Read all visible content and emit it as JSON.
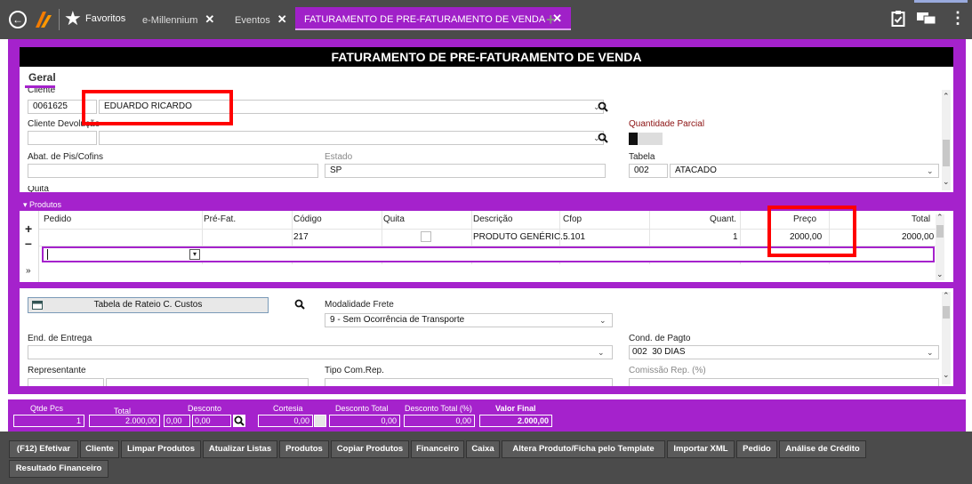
{
  "topbar": {
    "favoritos": "Favoritos",
    "tabs": [
      {
        "label": "e-Millennium"
      },
      {
        "label": "Eventos"
      },
      {
        "label": "FATURAMENTO DE PRE-FATURAMENTO DE VENDA"
      }
    ]
  },
  "title": "FATURAMENTO DE PRE-FATURAMENTO DE VENDA",
  "geral_tab": "Geral",
  "form": {
    "cliente_label": "Cliente",
    "cliente_code": "0061625",
    "cliente_name": "EDUARDO RICARDO",
    "cliente_devolucao_label": "Cliente Devolução",
    "quantidade_parcial_label": "Quantidade Parcial",
    "abat_label": "Abat. de Pis/Cofins",
    "estado_label": "Estado",
    "estado_value": "SP",
    "tabela_label": "Tabela",
    "tabela_code": "002",
    "tabela_name": "ATACADO",
    "quita_label": "Quita"
  },
  "produtos": {
    "header": "Produtos",
    "columns": [
      "Pedido",
      "Pré-Fat.",
      "Código",
      "Quita",
      "Descrição",
      "Cfop",
      "Quant.",
      "Preço",
      "Total"
    ],
    "rows": [
      {
        "codigo": "217",
        "descricao": "PRODUTO GENÉRIC...",
        "cfop": "5.101",
        "quant": "1",
        "preco": "2000,00",
        "total": "2000,00"
      }
    ]
  },
  "lower": {
    "tabela_rateio": "Tabela de Rateio C. Custos",
    "modalidade_label": "Modalidade Frete",
    "modalidade_value": "9 - Sem Ocorrência de Transporte",
    "end_entrega_label": "End. de Entrega",
    "cond_pagto_label": "Cond. de Pagto",
    "cond_pagto_code": "002",
    "cond_pagto_value": "30 DIAS",
    "representante_label": "Representante",
    "tipo_com_label": "Tipo Com.Rep.",
    "comissao_label": "Comissão Rep. (%)"
  },
  "summary": {
    "qtde_label": "Qtde Pcs",
    "qtde_value": "1",
    "total_label": "Total",
    "total_value": "2.000,00",
    "desconto_label": "Desconto",
    "desconto_a": "0,00",
    "desconto_b": "0,00",
    "cortesia_label": "Cortesia",
    "cortesia_value": "0,00",
    "desconto_total_label": "Desconto Total",
    "desconto_total_value": "0,00",
    "desconto_total_pct_label": "Desconto Total (%)",
    "desconto_total_pct_value": "0,00",
    "valor_final_label": "Valor Final",
    "valor_final_value": "2.000,00"
  },
  "buttons": {
    "efetivar": "(F12) Efetivar",
    "cliente": "Cliente",
    "limpar": "Limpar Produtos",
    "atualizar": "Atualizar Listas",
    "produtos": "Produtos",
    "copiar": "Copiar Produtos",
    "financeiro": "Financeiro",
    "caixa": "Caixa",
    "altera": "Altera Produto/Ficha pelo Template",
    "importar": "Importar XML",
    "pedido": "Pedido",
    "analise": "Análise de Crédito",
    "resultado": "Resultado Financeiro"
  },
  "colors": {
    "accent": "#a522cc",
    "topbar": "#4b4b4b",
    "highlight": "#ff0000",
    "label_red": "#8b1010"
  }
}
